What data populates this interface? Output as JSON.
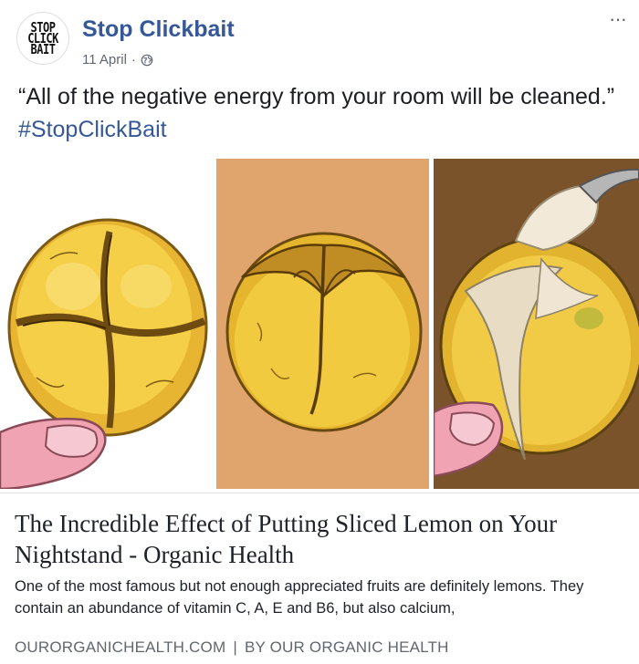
{
  "page": {
    "avatar_lines": [
      "STOP",
      "CLICK",
      "BAIT"
    ],
    "name": "Stop Clickbait",
    "date": "11 April",
    "dot": "·",
    "privacy_icon": "globe-icon",
    "more_label": "···"
  },
  "post": {
    "text": "“All of the negative energy from your room will be cleaned.”",
    "hashtag": "#StopClickBait"
  },
  "media": {
    "panels": [
      "lemon-cross-cut-held",
      "lemon-cut-top",
      "lemon-salt-spoon"
    ]
  },
  "link_preview": {
    "title": "The Incredible Effect of Putting Sliced Lemon on Your Nightstand - Organic Health",
    "description": "One of the most famous but not enough appreciated fruits are definitely lemons. They contain an abundance of vitamin C, A, E and B6, but also calcium,",
    "domain": "OURORGANICHEALTH.COM",
    "separator": "|",
    "author": "BY OUR ORGANIC HEALTH"
  },
  "colors": {
    "link_blue": "#365899",
    "secondary_text": "#606770",
    "lemon_yellow": "#f2c93a",
    "panel2_bg": "#dfa56d",
    "panel3_bg": "#7a532a"
  }
}
